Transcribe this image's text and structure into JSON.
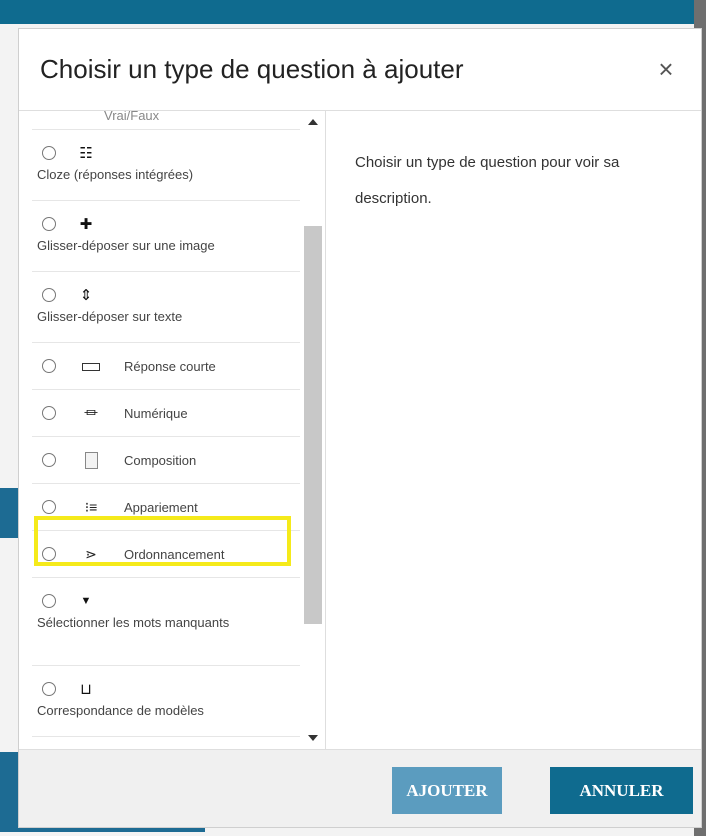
{
  "dialog": {
    "title": "Choisir un type de question à ajouter",
    "close_glyph": "×",
    "description": "Choisir un type de question pour voir sa description.",
    "add_label": "AJOUTER",
    "cancel_label": "ANNULER"
  },
  "question_types": [
    {
      "label": "Vrai/Faux",
      "icon": "truefalse-icon",
      "layout": "partial"
    },
    {
      "label": "Cloze (réponses intégrées)",
      "icon": "cloze-icon",
      "glyph": "☷",
      "layout": "stacked"
    },
    {
      "label": "Glisser-déposer sur une image",
      "icon": "move-icon",
      "glyph": "✚",
      "layout": "stacked"
    },
    {
      "label": "Glisser-déposer sur texte",
      "icon": "drag-arrows-icon",
      "glyph": "⇕",
      "layout": "stacked"
    },
    {
      "label": "Réponse courte",
      "icon": "short-answer-icon",
      "layout": "inline"
    },
    {
      "label": "Numérique",
      "icon": "numerical-icon",
      "glyph": "⏛",
      "layout": "inline"
    },
    {
      "label": "Composition",
      "icon": "essay-icon",
      "layout": "inline",
      "highlighted": true
    },
    {
      "label": "Appariement",
      "icon": "matching-icon",
      "glyph": "⁝≡",
      "layout": "inline"
    },
    {
      "label": "Ordonnancement",
      "icon": "ordering-icon",
      "glyph": "⋗",
      "layout": "inline"
    },
    {
      "label": "Sélectionner les mots manquants",
      "icon": "dropdown-icon",
      "glyph": "▼",
      "layout": "stacked"
    },
    {
      "label": "Correspondance de modèles",
      "icon": "pattern-match-icon",
      "glyph": "⊔",
      "layout": "stacked"
    }
  ],
  "colors": {
    "primary": "#0f6b8f",
    "primary_light": "#5b9cbf",
    "highlight": "#f5ea1a"
  }
}
